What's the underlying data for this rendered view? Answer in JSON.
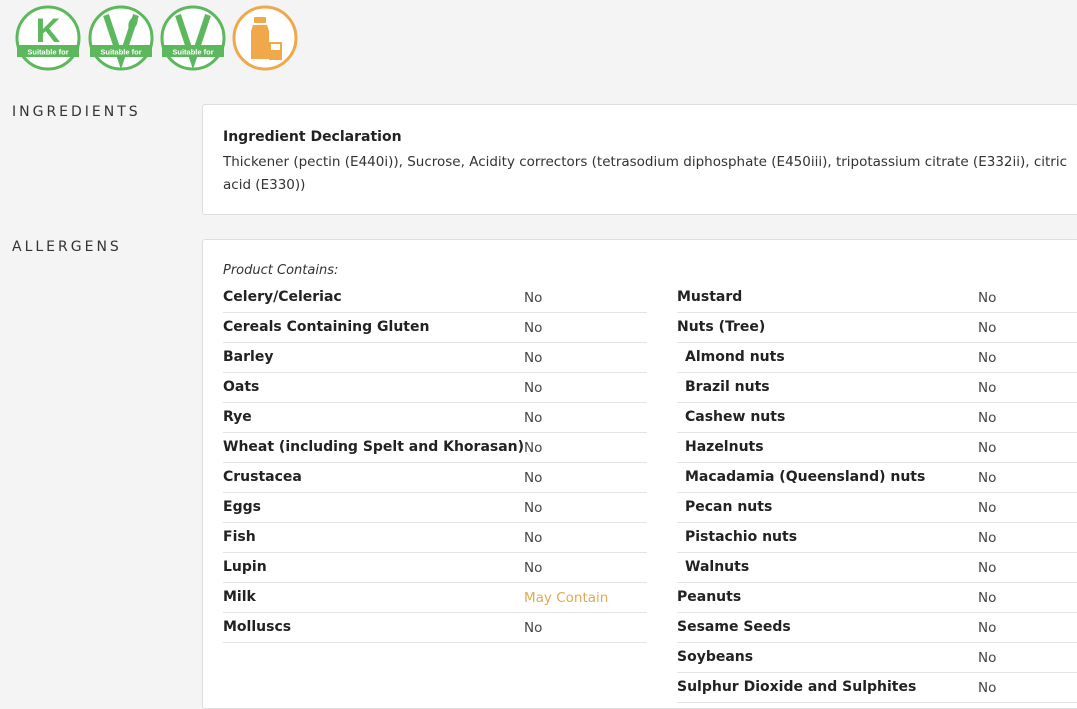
{
  "badges": [
    {
      "name": "kosher-badge",
      "letter": "K",
      "caption": "Suitable for",
      "color": "#5cb85c"
    },
    {
      "name": "vegetarian-badge",
      "letter": "V",
      "caption": "Suitable for",
      "color": "#5cb85c"
    },
    {
      "name": "vegan-badge",
      "letter": "V",
      "caption": "Suitable for",
      "color": "#5cb85c"
    },
    {
      "name": "milk-bottle-icon",
      "letter": "",
      "caption": "",
      "color": "#f0a84a"
    }
  ],
  "ingredients": {
    "label": "INGREDIENTS",
    "declaration_title": "Ingredient Declaration",
    "declaration_text": "Thickener (pectin (E440i)), Sucrose, Acidity correctors (tetrasodium diphosphate (E450iii), tripotassium citrate (E332ii), citric acid (E330))"
  },
  "allergens": {
    "label": "ALLERGENS",
    "contains_label": "Product Contains:",
    "left": [
      {
        "name": "Celery/Celeriac",
        "value": "No"
      },
      {
        "name": "Cereals Containing Gluten",
        "value": "No"
      },
      {
        "name": "Barley",
        "value": "No"
      },
      {
        "name": "Oats",
        "value": "No"
      },
      {
        "name": "Rye",
        "value": "No"
      },
      {
        "name": "Wheat (including Spelt and Khorasan)",
        "value": "No"
      },
      {
        "name": "Crustacea",
        "value": "No"
      },
      {
        "name": "Eggs",
        "value": "No"
      },
      {
        "name": "Fish",
        "value": "No"
      },
      {
        "name": "Lupin",
        "value": "No"
      },
      {
        "name": "Milk",
        "value": "May Contain"
      },
      {
        "name": "Molluscs",
        "value": "No"
      }
    ],
    "right": [
      {
        "name": "Mustard",
        "value": "No",
        "sub": false
      },
      {
        "name": "Nuts (Tree)",
        "value": "No",
        "sub": false
      },
      {
        "name": "Almond nuts",
        "value": "No",
        "sub": true
      },
      {
        "name": "Brazil nuts",
        "value": "No",
        "sub": true
      },
      {
        "name": "Cashew nuts",
        "value": "No",
        "sub": true
      },
      {
        "name": "Hazelnuts",
        "value": "No",
        "sub": true
      },
      {
        "name": "Macadamia (Queensland) nuts",
        "value": "No",
        "sub": true
      },
      {
        "name": "Pecan nuts",
        "value": "No",
        "sub": true
      },
      {
        "name": "Pistachio nuts",
        "value": "No",
        "sub": true
      },
      {
        "name": "Walnuts",
        "value": "No",
        "sub": true
      },
      {
        "name": "Peanuts",
        "value": "No",
        "sub": false
      },
      {
        "name": "Sesame Seeds",
        "value": "No",
        "sub": false
      },
      {
        "name": "Soybeans",
        "value": "No",
        "sub": false
      },
      {
        "name": "Sulphur Dioxide and Sulphites",
        "value": "No",
        "sub": false
      }
    ]
  },
  "colors": {
    "may_contain": "#e0aa55",
    "badge_green": "#5cb85c",
    "badge_orange": "#f0a84a"
  }
}
